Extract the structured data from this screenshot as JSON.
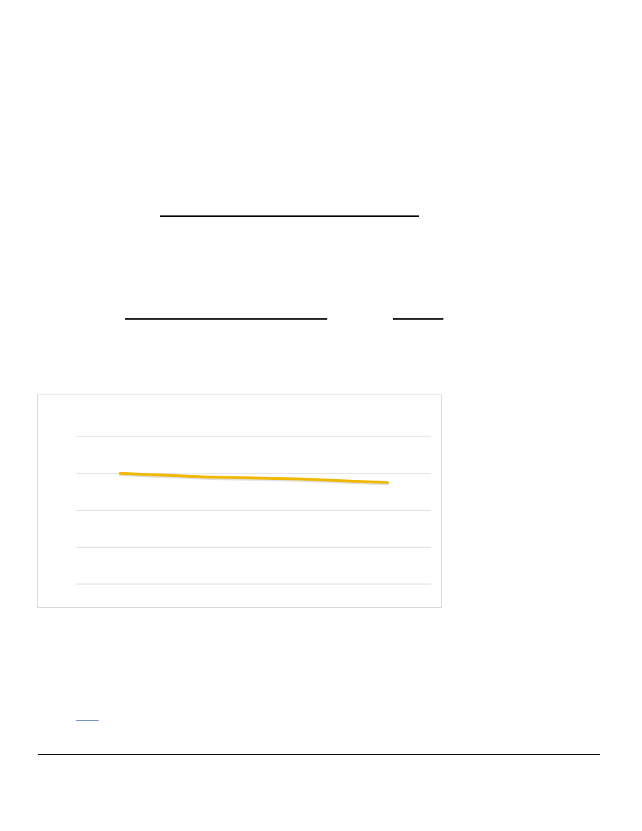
{
  "document": {
    "rules": [
      "rule-top",
      "rule-mid-left",
      "rule-mid-right"
    ]
  },
  "chart_data": {
    "type": "line",
    "title": "",
    "xlabel": "",
    "ylabel": "",
    "gridlines": 5,
    "grid": true,
    "legend": "none",
    "series": [
      {
        "values": [
          3.0,
          2.9,
          2.85,
          2.75
        ],
        "color": "#f0b800"
      }
    ],
    "ylim": [
      0,
      4
    ],
    "colors": {
      "grid": "#d9d9d9",
      "frame": "#d9d9d9"
    }
  }
}
